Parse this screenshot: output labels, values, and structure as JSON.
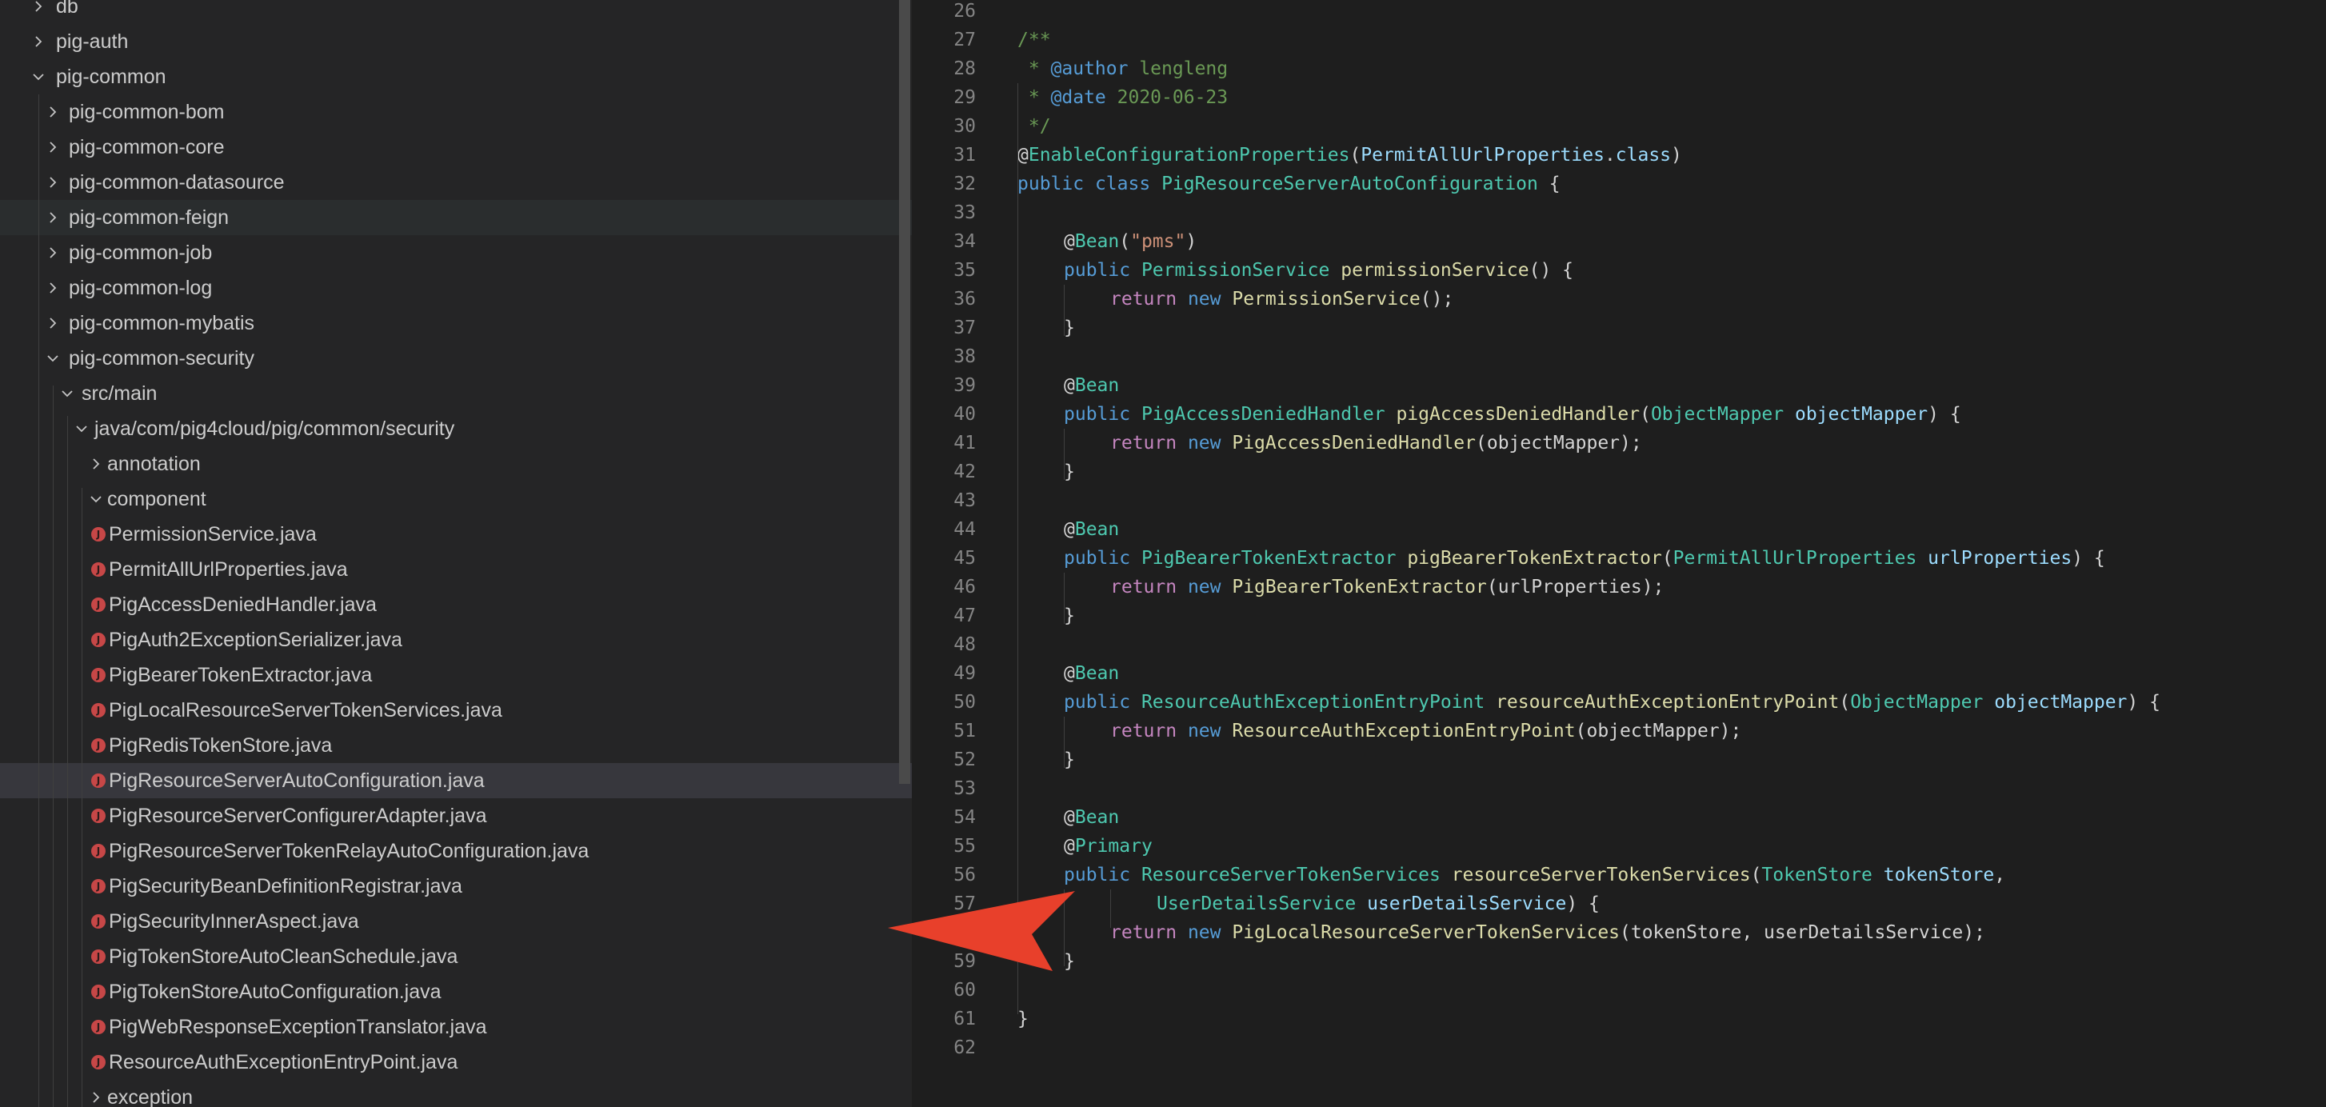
{
  "explorer": {
    "items": [
      {
        "label": "db",
        "depth": 0,
        "kind": "folder",
        "open": false
      },
      {
        "label": "pig-auth",
        "depth": 0,
        "kind": "folder",
        "open": false
      },
      {
        "label": "pig-common",
        "depth": 0,
        "kind": "folder",
        "open": true
      },
      {
        "label": "pig-common-bom",
        "depth": 1,
        "kind": "folder",
        "open": false
      },
      {
        "label": "pig-common-core",
        "depth": 1,
        "kind": "folder",
        "open": false
      },
      {
        "label": "pig-common-datasource",
        "depth": 1,
        "kind": "folder",
        "open": false
      },
      {
        "label": "pig-common-feign",
        "depth": 1,
        "kind": "folder",
        "open": false,
        "state": "hover"
      },
      {
        "label": "pig-common-job",
        "depth": 1,
        "kind": "folder",
        "open": false
      },
      {
        "label": "pig-common-log",
        "depth": 1,
        "kind": "folder",
        "open": false
      },
      {
        "label": "pig-common-mybatis",
        "depth": 1,
        "kind": "folder",
        "open": false
      },
      {
        "label": "pig-common-security",
        "depth": 1,
        "kind": "folder",
        "open": true
      },
      {
        "label": "src/main",
        "depth": 2,
        "kind": "folder",
        "open": true
      },
      {
        "label": "java/com/pig4cloud/pig/common/security",
        "depth": 3,
        "kind": "folder",
        "open": true
      },
      {
        "label": "annotation",
        "depth": 4,
        "kind": "folder",
        "open": false
      },
      {
        "label": "component",
        "depth": 4,
        "kind": "folder",
        "open": true
      },
      {
        "label": "PermissionService.java",
        "depth": 5,
        "kind": "java"
      },
      {
        "label": "PermitAllUrlProperties.java",
        "depth": 5,
        "kind": "java"
      },
      {
        "label": "PigAccessDeniedHandler.java",
        "depth": 5,
        "kind": "java"
      },
      {
        "label": "PigAuth2ExceptionSerializer.java",
        "depth": 5,
        "kind": "java"
      },
      {
        "label": "PigBearerTokenExtractor.java",
        "depth": 5,
        "kind": "java"
      },
      {
        "label": "PigLocalResourceServerTokenServices.java",
        "depth": 5,
        "kind": "java"
      },
      {
        "label": "PigRedisTokenStore.java",
        "depth": 5,
        "kind": "java"
      },
      {
        "label": "PigResourceServerAutoConfiguration.java",
        "depth": 5,
        "kind": "java",
        "state": "selected"
      },
      {
        "label": "PigResourceServerConfigurerAdapter.java",
        "depth": 5,
        "kind": "java"
      },
      {
        "label": "PigResourceServerTokenRelayAutoConfiguration.java",
        "depth": 5,
        "kind": "java"
      },
      {
        "label": "PigSecurityBeanDefinitionRegistrar.java",
        "depth": 5,
        "kind": "java"
      },
      {
        "label": "PigSecurityInnerAspect.java",
        "depth": 5,
        "kind": "java"
      },
      {
        "label": "PigTokenStoreAutoCleanSchedule.java",
        "depth": 5,
        "kind": "java"
      },
      {
        "label": "PigTokenStoreAutoConfiguration.java",
        "depth": 5,
        "kind": "java"
      },
      {
        "label": "PigWebResponseExceptionTranslator.java",
        "depth": 5,
        "kind": "java"
      },
      {
        "label": "ResourceAuthExceptionEntryPoint.java",
        "depth": 5,
        "kind": "java"
      },
      {
        "label": "exception",
        "depth": 4,
        "kind": "folder",
        "open": false
      }
    ]
  },
  "editor": {
    "lines": [
      {
        "n": "26",
        "indent": 0,
        "tokens": []
      },
      {
        "n": "27",
        "indent": 0,
        "tokens": [
          [
            "c-com",
            "/**"
          ]
        ]
      },
      {
        "n": "28",
        "indent": 0,
        "tokens": [
          [
            "c-com",
            " * "
          ],
          [
            "c-doctag",
            "@author"
          ],
          [
            "c-com",
            " lengleng"
          ]
        ]
      },
      {
        "n": "29",
        "indent": 0,
        "tokens": [
          [
            "c-com",
            " * "
          ],
          [
            "c-doctag",
            "@date"
          ],
          [
            "c-com",
            " 2020-06-23"
          ]
        ]
      },
      {
        "n": "30",
        "indent": 0,
        "tokens": [
          [
            "c-com",
            " */"
          ]
        ]
      },
      {
        "n": "31",
        "indent": 0,
        "tokens": [
          [
            "c-at",
            "@"
          ],
          [
            "c-ann",
            "EnableConfigurationProperties"
          ],
          [
            "c-pun",
            "("
          ],
          [
            "c-var",
            "PermitAllUrlProperties"
          ],
          [
            "c-pun",
            "."
          ],
          [
            "c-var",
            "class"
          ],
          [
            "c-pun",
            ")"
          ]
        ]
      },
      {
        "n": "32",
        "indent": 0,
        "tokens": [
          [
            "c-kw",
            "public"
          ],
          [
            "c-pun",
            " "
          ],
          [
            "c-kw",
            "class"
          ],
          [
            "c-pun",
            " "
          ],
          [
            "c-type",
            "PigResourceServerAutoConfiguration"
          ],
          [
            "c-pun",
            " {"
          ]
        ]
      },
      {
        "n": "33",
        "indent": 0,
        "tokens": []
      },
      {
        "n": "34",
        "indent": 1,
        "tokens": [
          [
            "c-at",
            "@"
          ],
          [
            "c-ann",
            "Bean"
          ],
          [
            "c-pun",
            "("
          ],
          [
            "c-str",
            "\"pms\""
          ],
          [
            "c-pun",
            ")"
          ]
        ]
      },
      {
        "n": "35",
        "indent": 1,
        "tokens": [
          [
            "c-kw",
            "public"
          ],
          [
            "c-pun",
            " "
          ],
          [
            "c-type",
            "PermissionService"
          ],
          [
            "c-pun",
            " "
          ],
          [
            "c-fn",
            "permissionService"
          ],
          [
            "c-pun",
            "() {"
          ]
        ]
      },
      {
        "n": "36",
        "indent": 2,
        "tokens": [
          [
            "c-ctl",
            "return"
          ],
          [
            "c-pun",
            " "
          ],
          [
            "c-kw",
            "new"
          ],
          [
            "c-pun",
            " "
          ],
          [
            "c-fn",
            "PermissionService"
          ],
          [
            "c-pun",
            "();"
          ]
        ]
      },
      {
        "n": "37",
        "indent": 1,
        "tokens": [
          [
            "c-pun",
            "}"
          ]
        ]
      },
      {
        "n": "38",
        "indent": 0,
        "tokens": []
      },
      {
        "n": "39",
        "indent": 1,
        "tokens": [
          [
            "c-at",
            "@"
          ],
          [
            "c-ann",
            "Bean"
          ]
        ]
      },
      {
        "n": "40",
        "indent": 1,
        "tokens": [
          [
            "c-kw",
            "public"
          ],
          [
            "c-pun",
            " "
          ],
          [
            "c-type",
            "PigAccessDeniedHandler"
          ],
          [
            "c-pun",
            " "
          ],
          [
            "c-fn",
            "pigAccessDeniedHandler"
          ],
          [
            "c-pun",
            "("
          ],
          [
            "c-type",
            "ObjectMapper"
          ],
          [
            "c-pun",
            " "
          ],
          [
            "c-var",
            "objectMapper"
          ],
          [
            "c-pun",
            ") {"
          ]
        ]
      },
      {
        "n": "41",
        "indent": 2,
        "tokens": [
          [
            "c-ctl",
            "return"
          ],
          [
            "c-pun",
            " "
          ],
          [
            "c-kw",
            "new"
          ],
          [
            "c-pun",
            " "
          ],
          [
            "c-fn",
            "PigAccessDeniedHandler"
          ],
          [
            "c-pun",
            "(objectMapper);"
          ]
        ]
      },
      {
        "n": "42",
        "indent": 1,
        "tokens": [
          [
            "c-pun",
            "}"
          ]
        ]
      },
      {
        "n": "43",
        "indent": 0,
        "tokens": []
      },
      {
        "n": "44",
        "indent": 1,
        "tokens": [
          [
            "c-at",
            "@"
          ],
          [
            "c-ann",
            "Bean"
          ]
        ]
      },
      {
        "n": "45",
        "indent": 1,
        "tokens": [
          [
            "c-kw",
            "public"
          ],
          [
            "c-pun",
            " "
          ],
          [
            "c-type",
            "PigBearerTokenExtractor"
          ],
          [
            "c-pun",
            " "
          ],
          [
            "c-fn",
            "pigBearerTokenExtractor"
          ],
          [
            "c-pun",
            "("
          ],
          [
            "c-type",
            "PermitAllUrlProperties"
          ],
          [
            "c-pun",
            " "
          ],
          [
            "c-var",
            "urlProperties"
          ],
          [
            "c-pun",
            ") {"
          ]
        ]
      },
      {
        "n": "46",
        "indent": 2,
        "tokens": [
          [
            "c-ctl",
            "return"
          ],
          [
            "c-pun",
            " "
          ],
          [
            "c-kw",
            "new"
          ],
          [
            "c-pun",
            " "
          ],
          [
            "c-fn",
            "PigBearerTokenExtractor"
          ],
          [
            "c-pun",
            "(urlProperties);"
          ]
        ]
      },
      {
        "n": "47",
        "indent": 1,
        "tokens": [
          [
            "c-pun",
            "}"
          ]
        ]
      },
      {
        "n": "48",
        "indent": 0,
        "tokens": []
      },
      {
        "n": "49",
        "indent": 1,
        "tokens": [
          [
            "c-at",
            "@"
          ],
          [
            "c-ann",
            "Bean"
          ]
        ]
      },
      {
        "n": "50",
        "indent": 1,
        "tokens": [
          [
            "c-kw",
            "public"
          ],
          [
            "c-pun",
            " "
          ],
          [
            "c-type",
            "ResourceAuthExceptionEntryPoint"
          ],
          [
            "c-pun",
            " "
          ],
          [
            "c-fn",
            "resourceAuthExceptionEntryPoint"
          ],
          [
            "c-pun",
            "("
          ],
          [
            "c-type",
            "ObjectMapper"
          ],
          [
            "c-pun",
            " "
          ],
          [
            "c-var",
            "objectMapper"
          ],
          [
            "c-pun",
            ") {"
          ]
        ]
      },
      {
        "n": "51",
        "indent": 2,
        "tokens": [
          [
            "c-ctl",
            "return"
          ],
          [
            "c-pun",
            " "
          ],
          [
            "c-kw",
            "new"
          ],
          [
            "c-pun",
            " "
          ],
          [
            "c-fn",
            "ResourceAuthExceptionEntryPoint"
          ],
          [
            "c-pun",
            "(objectMapper);"
          ]
        ]
      },
      {
        "n": "52",
        "indent": 1,
        "tokens": [
          [
            "c-pun",
            "}"
          ]
        ]
      },
      {
        "n": "53",
        "indent": 0,
        "tokens": []
      },
      {
        "n": "54",
        "indent": 1,
        "tokens": [
          [
            "c-at",
            "@"
          ],
          [
            "c-ann",
            "Bean"
          ]
        ]
      },
      {
        "n": "55",
        "indent": 1,
        "tokens": [
          [
            "c-at",
            "@"
          ],
          [
            "c-ann",
            "Primary"
          ]
        ]
      },
      {
        "n": "56",
        "indent": 1,
        "tokens": [
          [
            "c-kw",
            "public"
          ],
          [
            "c-pun",
            " "
          ],
          [
            "c-type",
            "ResourceServerTokenServices"
          ],
          [
            "c-pun",
            " "
          ],
          [
            "c-fn",
            "resourceServerTokenServices"
          ],
          [
            "c-pun",
            "("
          ],
          [
            "c-type",
            "TokenStore"
          ],
          [
            "c-pun",
            " "
          ],
          [
            "c-var",
            "tokenStore"
          ],
          [
            "c-pun",
            ","
          ]
        ]
      },
      {
        "n": "57",
        "indent": 3,
        "tokens": [
          [
            "c-type",
            "UserDetailsService"
          ],
          [
            "c-pun",
            " "
          ],
          [
            "c-var",
            "userDetailsService"
          ],
          [
            "c-pun",
            ") {"
          ]
        ]
      },
      {
        "n": "58",
        "indent": 2,
        "tokens": [
          [
            "c-ctl",
            "return"
          ],
          [
            "c-pun",
            " "
          ],
          [
            "c-kw",
            "new"
          ],
          [
            "c-pun",
            " "
          ],
          [
            "c-fn",
            "PigLocalResourceServerTokenServices"
          ],
          [
            "c-pun",
            "(tokenStore, userDetailsService);"
          ]
        ]
      },
      {
        "n": "59",
        "indent": 1,
        "tokens": [
          [
            "c-pun",
            "}"
          ]
        ]
      },
      {
        "n": "60",
        "indent": 0,
        "tokens": []
      },
      {
        "n": "61",
        "indent": 0,
        "tokens": [
          [
            "c-pun",
            "}"
          ]
        ]
      },
      {
        "n": "62",
        "indent": 0,
        "tokens": []
      }
    ]
  },
  "annotation_arrow": {
    "color": "#e8402b",
    "icon": "arrow-right-icon"
  }
}
